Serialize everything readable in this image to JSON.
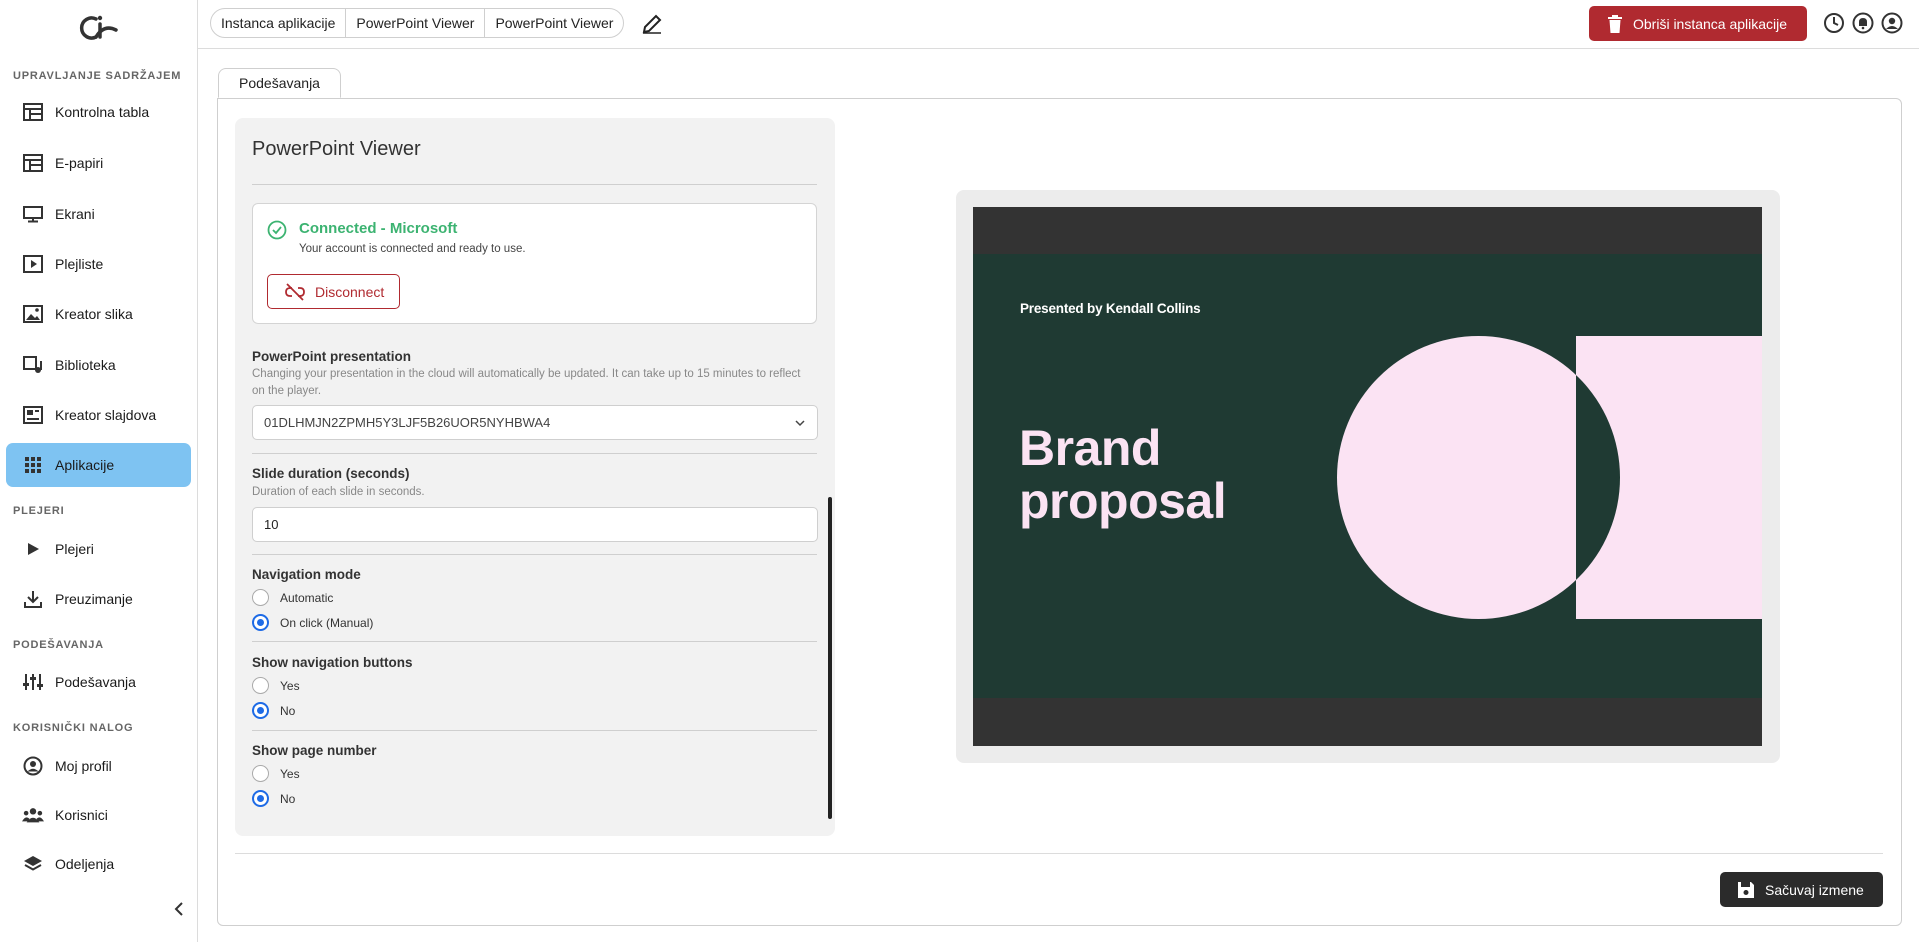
{
  "sidebar": {
    "sections": {
      "content": "UPRAVLJANJE SADRŽAJEM",
      "players": "PLEJERI",
      "settings": "PODEŠAVANJA",
      "account": "KORISNIČKI NALOG"
    },
    "items": [
      {
        "label": "Kontrolna tabla",
        "icon": "dashboard-icon"
      },
      {
        "label": "E-papiri",
        "icon": "epaper-icon"
      },
      {
        "label": "Ekrani",
        "icon": "monitor-icon"
      },
      {
        "label": "Plejliste",
        "icon": "playlist-icon"
      },
      {
        "label": "Kreator slika",
        "icon": "image-icon"
      },
      {
        "label": "Biblioteka",
        "icon": "library-icon"
      },
      {
        "label": "Kreator slajdova",
        "icon": "slides-icon"
      },
      {
        "label": "Aplikacije",
        "icon": "apps-icon",
        "active": true
      },
      {
        "label": "Plejeri",
        "icon": "play-icon"
      },
      {
        "label": "Preuzimanje",
        "icon": "download-icon"
      },
      {
        "label": "Podešavanja",
        "icon": "sliders-icon"
      },
      {
        "label": "Moj profil",
        "icon": "profile-icon"
      },
      {
        "label": "Korisnici",
        "icon": "users-icon"
      },
      {
        "label": "Odeljenja",
        "icon": "layers-icon"
      }
    ]
  },
  "topbar": {
    "breadcrumbs": [
      "Instanca aplikacije",
      "PowerPoint Viewer",
      "PowerPoint Viewer"
    ],
    "delete_label": "Obriši instanca aplikacije"
  },
  "tab": {
    "label": "Podešavanja"
  },
  "settings": {
    "title": "PowerPoint Viewer",
    "connection": {
      "title": "Connected - Microsoft",
      "subtitle": "Your account is connected and ready to use.",
      "disconnect_label": "Disconnect"
    },
    "presentation": {
      "label": "PowerPoint presentation",
      "help": "Changing your presentation in the cloud will automatically be updated. It can take up to 15 minutes to reflect on the player.",
      "value": "01DLHMJN2ZPMH5Y3LJF5B26UOR5NYHBWA4"
    },
    "duration": {
      "label": "Slide duration (seconds)",
      "help": "Duration of each slide in seconds.",
      "value": "10"
    },
    "navigation_mode": {
      "label": "Navigation mode",
      "options": [
        "Automatic",
        "On click (Manual)"
      ],
      "selected": "On click (Manual)"
    },
    "show_nav_buttons": {
      "label": "Show navigation buttons",
      "options": [
        "Yes",
        "No"
      ],
      "selected": "No"
    },
    "show_page_number": {
      "label": "Show page number",
      "options": [
        "Yes",
        "No"
      ],
      "selected": "No"
    }
  },
  "preview": {
    "presented_by": "Presented by Kendall Collins",
    "headline_line1": "Brand",
    "headline_line2": "proposal"
  },
  "save_label": "Sačuvaj izmene",
  "colors": {
    "accent_active": "#7ec3f2",
    "danger": "#b02a30",
    "success": "#3cb371",
    "radio": "#1e6be6",
    "slide_bg": "#1f3a33",
    "slide_pink": "#fbe3f3"
  }
}
